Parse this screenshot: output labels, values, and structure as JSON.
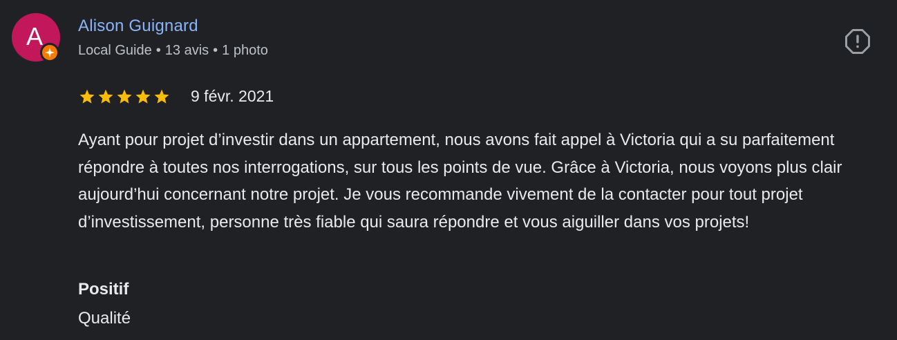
{
  "reviewer": {
    "initial": "A",
    "name": "Alison Guignard",
    "level": "Local Guide",
    "reviews_count": "13 avis",
    "photos_count": "1 photo",
    "separator": "•",
    "avatar_color": "#c2185b",
    "badge_color": "#f57c00",
    "badge_icon": "local-guide-star-icon"
  },
  "review": {
    "rating": 5,
    "rating_max": 5,
    "star_color": "#fbbc04",
    "date": "9 févr. 2021",
    "text": "Ayant pour projet d’investir dans un appartement, nous avons fait appel à Victoria qui a su parfaitement répondre à toutes nos interrogations, sur tous les points de vue. Grâce à Victoria, nous voyons plus clair aujourd’hui concernant notre projet. Je vous recommande vivement de la contacter pour tout projet d’investissement, personne très fiable qui saura répondre et vous aiguiller dans vos projets!",
    "positive": {
      "label": "Positif",
      "value": "Qualité"
    }
  },
  "actions": {
    "report_icon": "report-icon"
  },
  "colors": {
    "background": "#202124",
    "name_link": "#8ab4f8",
    "text": "#e8eaed",
    "meta_text": "#bdc1c6"
  }
}
